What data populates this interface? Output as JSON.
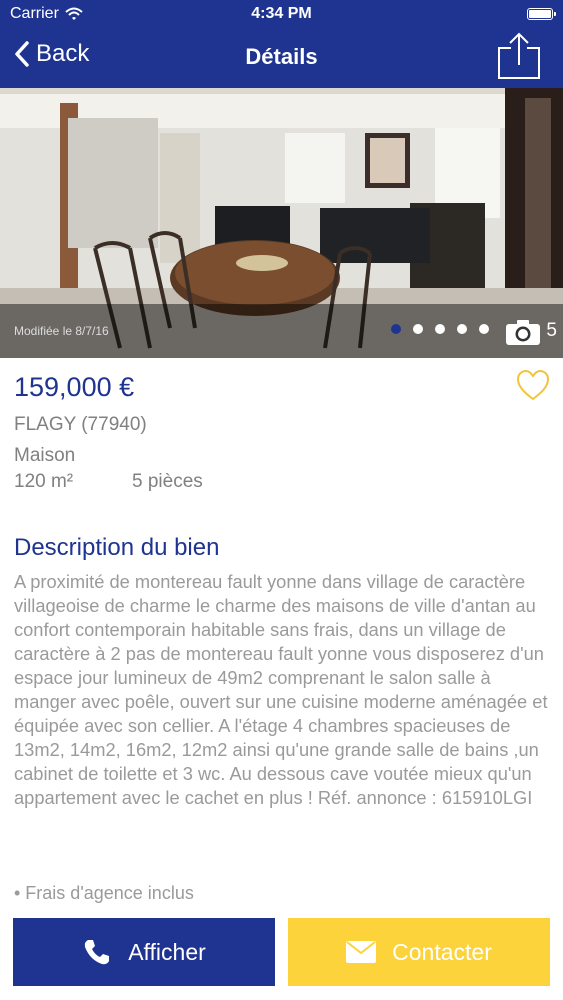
{
  "status_bar": {
    "carrier": "Carrier",
    "time": "4:34 PM"
  },
  "nav": {
    "back_label": "Back",
    "title": "Détails"
  },
  "photo": {
    "modified": "Modifiée le 8/7/16",
    "count": "5",
    "current_index": 1,
    "total_dots": 5
  },
  "listing": {
    "price": "159,000 €",
    "city": "FLAGY (77940)",
    "type": "Maison",
    "surface": "120 m²",
    "rooms": "5 pièces"
  },
  "description": {
    "title": "Description du bien",
    "text": "A proximité de montereau fault yonne dans village de caractère villageoise de charme le charme des maisons de ville d'antan au confort contemporain habitable sans frais, dans un village de caractère à 2 pas de montereau fault yonne vous disposerez d'un espace jour lumineux de 49m2 comprenant le salon salle à manger avec poêle, ouvert sur une cuisine moderne aménagée et équipée avec son cellier. A l'étage 4 chambres spacieuses de 13m2, 14m2, 16m2, 12m2 ainsi qu'une grande salle de bains ,un cabinet de toilette et 3 wc. Au dessous cave voutée mieux qu'un appartement avec le cachet en plus ! Réf. annonce : 615910LGI",
    "fees": "• Frais d'agence inclus"
  },
  "actions": {
    "call_label": "Afficher",
    "contact_label": "Contacter"
  },
  "colors": {
    "brand_blue": "#1f3490",
    "accent_yellow": "#fcd33a",
    "text_gray": "#9a9a9a"
  },
  "icons": [
    "wifi-icon",
    "battery-icon",
    "back-chevron-icon",
    "share-icon",
    "camera-icon",
    "heart-icon",
    "phone-icon",
    "envelope-icon"
  ]
}
